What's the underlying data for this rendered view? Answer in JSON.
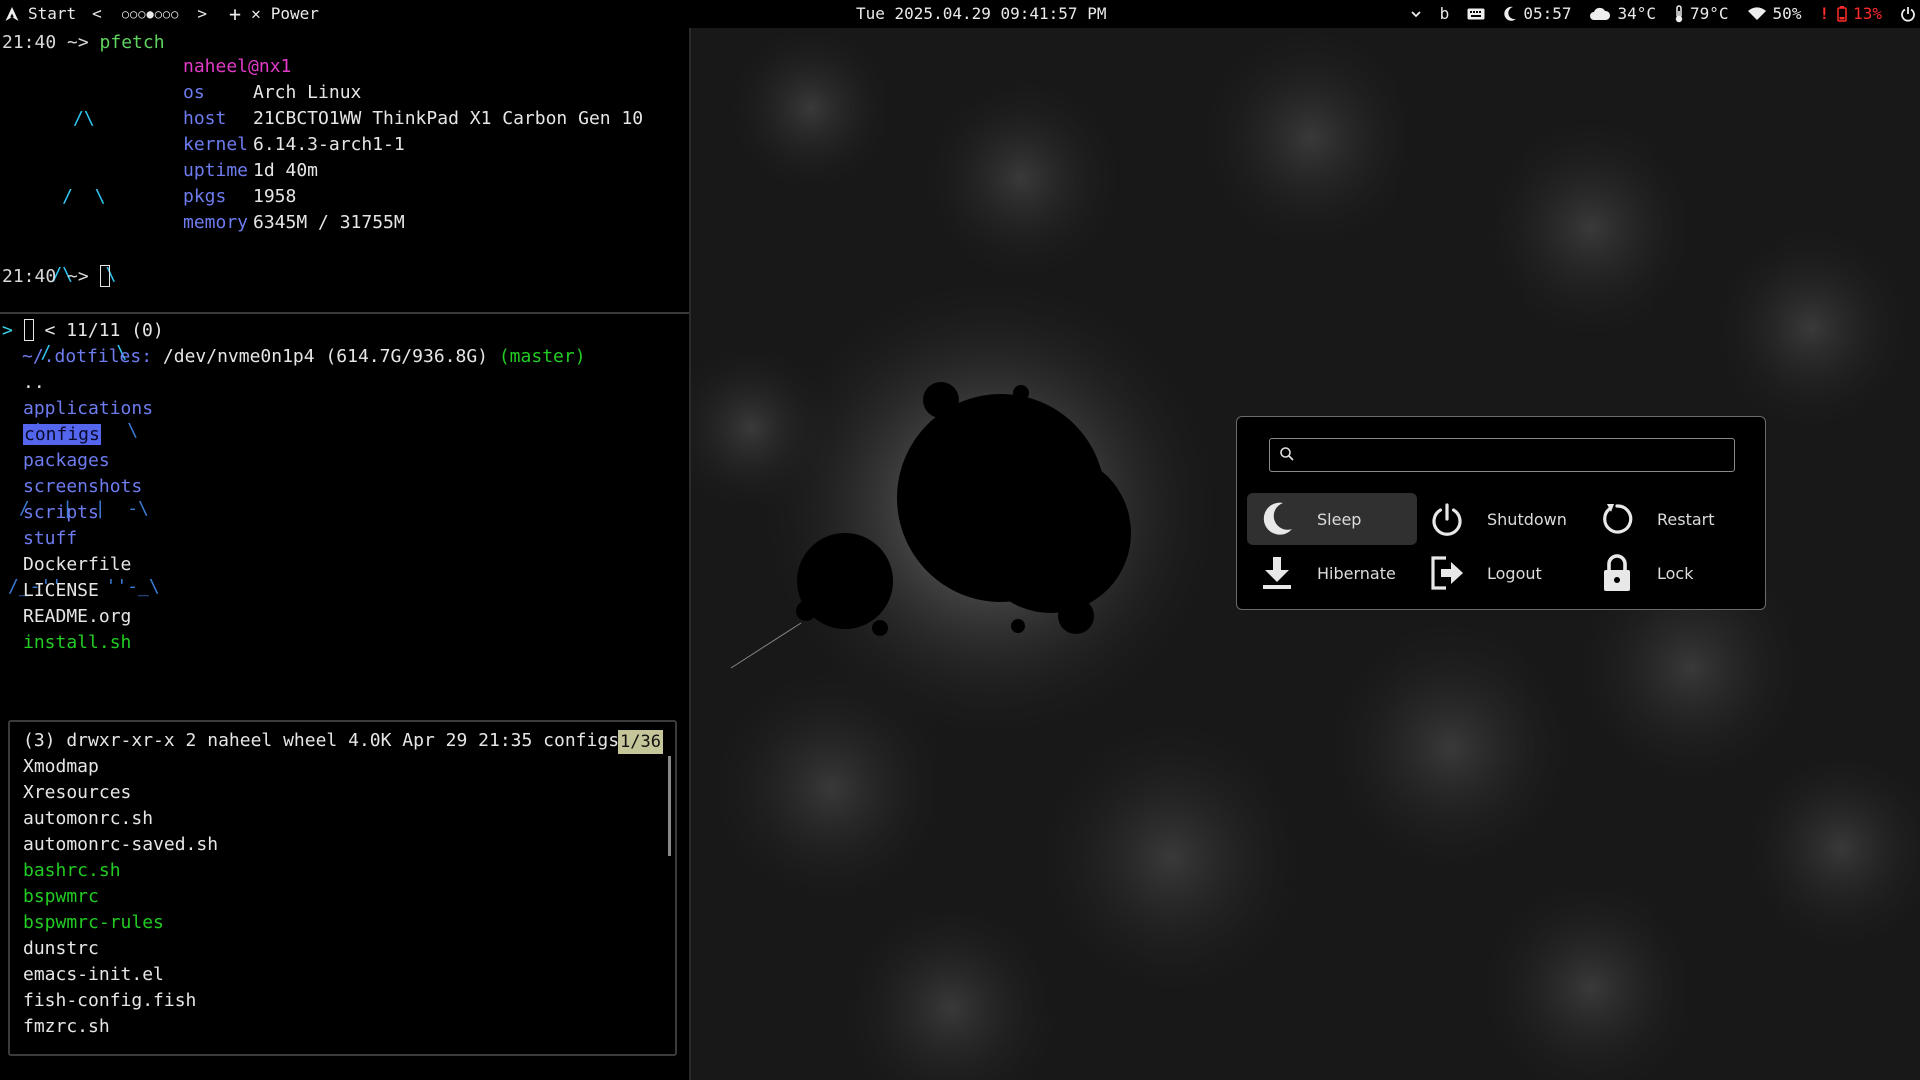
{
  "topbar": {
    "start_label": "Start",
    "nav_prev": "<",
    "workspaces": "○○○●○○○",
    "nav_next": ">",
    "add": "+",
    "close": "✕",
    "window_title": "Power",
    "datetime": "Tue 2025.04.29 09:41:57 PM",
    "chevron": "⌄",
    "keyboard_layout": "b",
    "moon_time": "05:57",
    "weather_temp": "34°C",
    "cpu_temp": "79°C",
    "wifi_strength": "50%",
    "battery_alert": "!",
    "battery_level": "13%"
  },
  "terminal": {
    "prompt1_time": "21:40",
    "prompt1_arrow": " ~> ",
    "prompt1_cmd": "pfetch",
    "logo_lines": [
      "      /\\",
      "     /  \\",
      "    /\\   \\",
      "   /      \\",
      "  /   ,,   \\",
      " /   |  |  -\\",
      "/_-''    ''-_\\"
    ],
    "user_host": "naheel@nx1",
    "info": [
      {
        "key": "os",
        "value": "Arch Linux"
      },
      {
        "key": "host",
        "value": "21CBCTO1WW ThinkPad X1 Carbon Gen 10"
      },
      {
        "key": "kernel",
        "value": "6.14.3-arch1-1"
      },
      {
        "key": "uptime",
        "value": "1d 40m"
      },
      {
        "key": "pkgs",
        "value": "1958"
      },
      {
        "key": "memory",
        "value": "6345M / 31755M"
      }
    ],
    "prompt2_time": "21:40",
    "prompt2_arrow": " ~> "
  },
  "filemanager": {
    "header_prompt": "> ",
    "header_counter": " < 11/11 (0)",
    "path_dir": "~/.dotfiles: ",
    "path_dev": "/dev/nvme0n1p4 (614.7G/936.8G) ",
    "path_branch": "(master)",
    "entries": [
      {
        "name": "..",
        "kind": "plain"
      },
      {
        "name": "applications",
        "kind": "dir"
      },
      {
        "name": "configs",
        "kind": "selected"
      },
      {
        "name": "packages",
        "kind": "dir"
      },
      {
        "name": "screenshots",
        "kind": "dir"
      },
      {
        "name": "scripts",
        "kind": "dir"
      },
      {
        "name": "stuff",
        "kind": "dir"
      },
      {
        "name": "Dockerfile",
        "kind": "plain"
      },
      {
        "name": "LICENSE",
        "kind": "plain"
      },
      {
        "name": "README.org",
        "kind": "plain"
      },
      {
        "name": "install.sh",
        "kind": "exe"
      }
    ],
    "preview_header": "(3) drwxr-xr-x 2 naheel wheel 4.0K Apr 29 21:35 configs",
    "preview_count": "1/36",
    "preview_entries": [
      {
        "name": "Xmodmap",
        "kind": "plain"
      },
      {
        "name": "Xresources",
        "kind": "plain"
      },
      {
        "name": "automonrc.sh",
        "kind": "plain"
      },
      {
        "name": "automonrc-saved.sh",
        "kind": "plain"
      },
      {
        "name": "bashrc.sh",
        "kind": "exe"
      },
      {
        "name": "bspwmrc",
        "kind": "exe"
      },
      {
        "name": "bspwmrc-rules",
        "kind": "exe"
      },
      {
        "name": "dunstrc",
        "kind": "plain"
      },
      {
        "name": "emacs-init.el",
        "kind": "plain"
      },
      {
        "name": "fish-config.fish",
        "kind": "plain"
      },
      {
        "name": "fmzrc.sh",
        "kind": "plain"
      }
    ]
  },
  "power_menu": {
    "search_value": "",
    "buttons": [
      {
        "label": "Sleep",
        "icon": "moon-icon",
        "active": true
      },
      {
        "label": "Shutdown",
        "icon": "power-icon",
        "active": false
      },
      {
        "label": "Restart",
        "icon": "restart-icon",
        "active": false
      },
      {
        "label": "Hibernate",
        "icon": "download-icon",
        "active": false
      },
      {
        "label": "Logout",
        "icon": "logout-icon",
        "active": false
      },
      {
        "label": "Lock",
        "icon": "lock-icon",
        "active": false
      }
    ]
  }
}
